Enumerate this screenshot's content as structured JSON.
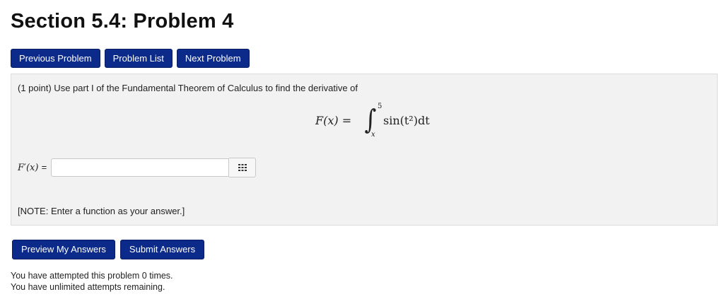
{
  "header": {
    "title": "Section 5.4: Problem 4"
  },
  "nav": {
    "previous_label": "Previous Problem",
    "list_label": "Problem List",
    "next_label": "Next Problem"
  },
  "problem": {
    "prompt": "(1 point) Use part I of the Fundamental Theorem of Calculus to find the derivative of",
    "equation": {
      "lhs": "F(x) =",
      "integral_symbol": "∫",
      "upper_limit": "5",
      "lower_limit": "x",
      "integrand": "sin(t²)dt"
    },
    "answer": {
      "label": "F′(x)",
      "equals": "=",
      "value": "",
      "placeholder": ""
    },
    "keypad_icon": "grid-keypad-icon",
    "note": "[NOTE: Enter a function as your answer.]"
  },
  "actions": {
    "preview_label": "Preview My Answers",
    "submit_label": "Submit Answers"
  },
  "status": {
    "attempts": "You have attempted this problem 0 times.",
    "remaining": "You have unlimited attempts remaining."
  },
  "colors": {
    "button_bg": "#0b2a8a",
    "panel_bg": "#f2f2f2"
  }
}
